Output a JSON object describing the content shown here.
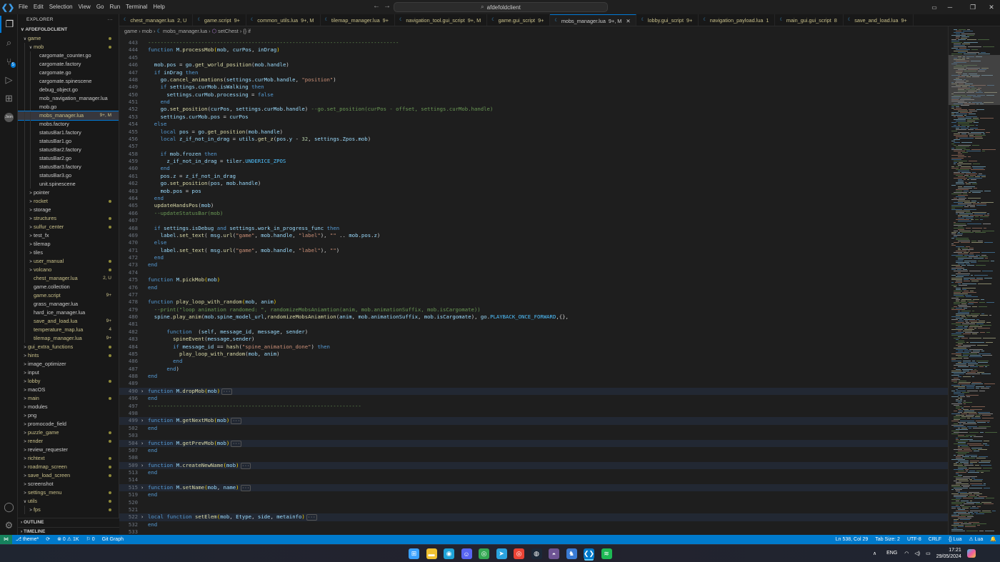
{
  "menu": [
    "File",
    "Edit",
    "Selection",
    "View",
    "Go",
    "Run",
    "Terminal",
    "Help"
  ],
  "command_center": "afdefoldclient",
  "window_controls": [
    "─",
    "❐",
    "✕"
  ],
  "explorer": {
    "title": "EXPLORER",
    "project": "AFDEFOLDCLIENT",
    "rows": [
      {
        "label": "game",
        "chev": "∨",
        "indent": 0,
        "color": "#c9c08a",
        "dot": true
      },
      {
        "label": "mob",
        "chev": "∨",
        "indent": 1,
        "color": "#c9c08a",
        "dot": true
      },
      {
        "label": "cargomate_counter.go",
        "chev": "",
        "indent": 2,
        "color": "#cccccc"
      },
      {
        "label": "cargomate.factory",
        "chev": "",
        "indent": 2,
        "color": "#cccccc"
      },
      {
        "label": "cargomate.go",
        "chev": "",
        "indent": 2,
        "color": "#cccccc"
      },
      {
        "label": "cargomate.spinescene",
        "chev": "",
        "indent": 2,
        "color": "#cccccc"
      },
      {
        "label": "debug_object.go",
        "chev": "",
        "indent": 2,
        "color": "#cccccc"
      },
      {
        "label": "mob_navigation_manager.lua",
        "chev": "",
        "indent": 2,
        "color": "#cccccc"
      },
      {
        "label": "mob.go",
        "chev": "",
        "indent": 2,
        "color": "#cccccc"
      },
      {
        "label": "mobs_manager.lua",
        "chev": "",
        "indent": 2,
        "color": "#c9c08a",
        "status": "9+, M",
        "selected": true
      },
      {
        "label": "mobs.factory",
        "chev": "",
        "indent": 2,
        "color": "#cccccc"
      },
      {
        "label": "statusBar1.factory",
        "chev": "",
        "indent": 2,
        "color": "#cccccc"
      },
      {
        "label": "statusBar1.go",
        "chev": "",
        "indent": 2,
        "color": "#cccccc"
      },
      {
        "label": "statusBar2.factory",
        "chev": "",
        "indent": 2,
        "color": "#cccccc"
      },
      {
        "label": "statusBar2.go",
        "chev": "",
        "indent": 2,
        "color": "#cccccc"
      },
      {
        "label": "statusBar3.factory",
        "chev": "",
        "indent": 2,
        "color": "#cccccc"
      },
      {
        "label": "statusBar3.go",
        "chev": "",
        "indent": 2,
        "color": "#cccccc"
      },
      {
        "label": "unit.spinescene",
        "chev": "",
        "indent": 2,
        "color": "#cccccc"
      },
      {
        "label": "pointer",
        "chev": ">",
        "indent": 1,
        "color": "#cccccc"
      },
      {
        "label": "rocket",
        "chev": ">",
        "indent": 1,
        "color": "#c9c08a",
        "dot": true
      },
      {
        "label": "storage",
        "chev": ">",
        "indent": 1,
        "color": "#cccccc"
      },
      {
        "label": "structures",
        "chev": ">",
        "indent": 1,
        "color": "#c9c08a",
        "dot": true
      },
      {
        "label": "sulfur_center",
        "chev": ">",
        "indent": 1,
        "color": "#c9c08a",
        "dot": true
      },
      {
        "label": "test_fx",
        "chev": ">",
        "indent": 1,
        "color": "#cccccc"
      },
      {
        "label": "tilemap",
        "chev": ">",
        "indent": 1,
        "color": "#cccccc"
      },
      {
        "label": "tiles",
        "chev": ">",
        "indent": 1,
        "color": "#cccccc"
      },
      {
        "label": "user_manual",
        "chev": ">",
        "indent": 1,
        "color": "#c9c08a",
        "dot": true
      },
      {
        "label": "volcano",
        "chev": ">",
        "indent": 1,
        "color": "#c9c08a",
        "dot": true
      },
      {
        "label": "chest_manager.lua",
        "chev": "",
        "indent": 1,
        "color": "#c9c08a",
        "status": "2, U"
      },
      {
        "label": "game.collection",
        "chev": "",
        "indent": 1,
        "color": "#cccccc"
      },
      {
        "label": "game.script",
        "chev": "",
        "indent": 1,
        "color": "#c9c08a",
        "status": "9+"
      },
      {
        "label": "grass_manager.lua",
        "chev": "",
        "indent": 1,
        "color": "#cccccc"
      },
      {
        "label": "hard_ice_manager.lua",
        "chev": "",
        "indent": 1,
        "color": "#cccccc"
      },
      {
        "label": "save_and_load.lua",
        "chev": "",
        "indent": 1,
        "color": "#c9c08a",
        "status": "9+"
      },
      {
        "label": "temperature_map.lua",
        "chev": "",
        "indent": 1,
        "color": "#c9c08a",
        "status": "4"
      },
      {
        "label": "tilemap_manager.lua",
        "chev": "",
        "indent": 1,
        "color": "#c9c08a",
        "status": "9+"
      },
      {
        "label": "gui_extra_functions",
        "chev": ">",
        "indent": 0,
        "color": "#c9c08a",
        "dot": true
      },
      {
        "label": "hints",
        "chev": ">",
        "indent": 0,
        "color": "#c9c08a",
        "dot": true
      },
      {
        "label": "image_optimizer",
        "chev": ">",
        "indent": 0,
        "color": "#cccccc"
      },
      {
        "label": "input",
        "chev": ">",
        "indent": 0,
        "color": "#cccccc"
      },
      {
        "label": "lobby",
        "chev": ">",
        "indent": 0,
        "color": "#c9c08a",
        "dot": true
      },
      {
        "label": "macOS",
        "chev": ">",
        "indent": 0,
        "color": "#cccccc"
      },
      {
        "label": "main",
        "chev": ">",
        "indent": 0,
        "color": "#c9c08a",
        "dot": true
      },
      {
        "label": "modules",
        "chev": ">",
        "indent": 0,
        "color": "#cccccc"
      },
      {
        "label": "png",
        "chev": ">",
        "indent": 0,
        "color": "#cccccc"
      },
      {
        "label": "promocode_field",
        "chev": ">",
        "indent": 0,
        "color": "#cccccc"
      },
      {
        "label": "puzzle_game",
        "chev": ">",
        "indent": 0,
        "color": "#c9c08a",
        "dot": true
      },
      {
        "label": "render",
        "chev": ">",
        "indent": 0,
        "color": "#c9c08a",
        "dot": true
      },
      {
        "label": "review_requester",
        "chev": ">",
        "indent": 0,
        "color": "#cccccc"
      },
      {
        "label": "richtext",
        "chev": ">",
        "indent": 0,
        "color": "#c9c08a",
        "dot": true
      },
      {
        "label": "roadmap_screen",
        "chev": ">",
        "indent": 0,
        "color": "#c9c08a",
        "dot": true
      },
      {
        "label": "save_load_screen",
        "chev": ">",
        "indent": 0,
        "color": "#c9c08a",
        "dot": true
      },
      {
        "label": "screenshot",
        "chev": ">",
        "indent": 0,
        "color": "#cccccc"
      },
      {
        "label": "settings_menu",
        "chev": ">",
        "indent": 0,
        "color": "#c9c08a",
        "dot": true
      },
      {
        "label": "utils",
        "chev": "∨",
        "indent": 0,
        "color": "#c9c08a",
        "dot": true
      },
      {
        "label": "fps",
        "chev": ">",
        "indent": 1,
        "color": "#c9c08a",
        "dot": true
      }
    ],
    "outline": "OUTLINE",
    "timeline": "TIMELINE"
  },
  "tabs": [
    {
      "label": "chest_manager.lua",
      "status": "2, U"
    },
    {
      "label": "game.script",
      "status": "9+"
    },
    {
      "label": "common_utils.lua",
      "status": "9+, M"
    },
    {
      "label": "tilemap_manager.lua",
      "status": "9+"
    },
    {
      "label": "navigation_tool.gui_script",
      "status": "9+, M"
    },
    {
      "label": "game.gui_script",
      "status": "9+"
    },
    {
      "label": "mobs_manager.lua",
      "status": "9+, M",
      "active": true
    },
    {
      "label": "lobby.gui_script",
      "status": "9+"
    },
    {
      "label": "navigation_payload.lua",
      "status": "1"
    },
    {
      "label": "main_gui.gui_script",
      "status": "8"
    },
    {
      "label": "save_and_load.lua",
      "status": "9+"
    }
  ],
  "breadcrumb": [
    "game",
    "mob",
    "mobs_manager.lua",
    "setChest",
    "{} if"
  ],
  "code_lines": [
    {
      "n": "443",
      "t": "--------------------------------------------------------------------------------",
      "cls": "c"
    },
    {
      "n": "444",
      "h": "<span class='k'>function</span> <span class='v'>M</span>.<span class='f'>processMob</span><span class='p'>(</span><span class='v'>mob</span>, <span class='v'>curPos</span>, <span class='v'>inDrag</span><span class='p'>)</span>"
    },
    {
      "n": "445",
      "h": ""
    },
    {
      "n": "446",
      "h": "  <span class='v'>mob</span>.<span class='v'>pos</span> = <span class='v'>go</span>.<span class='f'>get_world_position</span>(<span class='v'>mob</span>.<span class='v'>handle</span>)"
    },
    {
      "n": "447",
      "h": "  <span class='k'>if</span> <span class='v'>inDrag</span> <span class='k'>then</span>"
    },
    {
      "n": "448",
      "h": "    <span class='v'>go</span>.<span class='f'>cancel_animations</span>(<span class='v'>settings</span>.<span class='v'>curMob</span>.<span class='v'>handle</span>, <span class='s'>\"position\"</span>)"
    },
    {
      "n": "449",
      "h": "    <span class='k'>if</span> <span class='v'>settings</span>.<span class='v'>curMob</span>.<span class='v'>isWalking</span> <span class='k'>then</span>"
    },
    {
      "n": "450",
      "h": "      <span class='v'>settings</span>.<span class='v'>curMob</span>.<span class='v'>processing</span> = <span class='k'>false</span>"
    },
    {
      "n": "451",
      "h": "    <span class='k'>end</span>"
    },
    {
      "n": "452",
      "h": "    <span class='v'>go</span>.<span class='f'>set_position</span>(<span class='v'>curPos</span>, <span class='v'>settings</span>.<span class='v'>curMob</span>.<span class='v'>handle</span>) <span class='c'>--go.set_position(curPos - offset, settings.curMob.handle)</span>"
    },
    {
      "n": "453",
      "h": "    <span class='v'>settings</span>.<span class='v'>curMob</span>.<span class='v'>pos</span> = <span class='v'>curPos</span>"
    },
    {
      "n": "454",
      "h": "  <span class='k'>else</span>"
    },
    {
      "n": "455",
      "h": "    <span class='k'>local</span> <span class='v'>pos</span> = <span class='v'>go</span>.<span class='f'>get_position</span>(<span class='v'>mob</span>.<span class='v'>handle</span>)"
    },
    {
      "n": "456",
      "h": "    <span class='k'>local</span> <span class='v'>z_if_not_in_drag</span> = <span class='v'>utils</span>.<span class='f'>get_z</span>(<span class='v'>pos</span>.<span class='v'>y</span> - <span class='n'>32</span>, <span class='v'>settings</span>.<span class='v'>Zpos</span>.<span class='v'>mob</span>)"
    },
    {
      "n": "457",
      "h": ""
    },
    {
      "n": "458",
      "h": "    <span class='k'>if</span> <span class='v'>mob</span>.<span class='v'>frozen</span> <span class='k'>then</span>"
    },
    {
      "n": "459",
      "h": "      <span class='v'>z_if_not_in_drag</span> = <span class='v'>tiler</span>.<span class='cs'>UNDERICE_ZPOS</span>"
    },
    {
      "n": "460",
      "h": "    <span class='k'>end</span>"
    },
    {
      "n": "461",
      "h": "    <span class='v'>pos</span>.<span class='v'>z</span> = <span class='v'>z_if_not_in_drag</span>"
    },
    {
      "n": "462",
      "h": "    <span class='v'>go</span>.<span class='f'>set_position</span>(<span class='v'>pos</span>, <span class='v'>mob</span>.<span class='v'>handle</span>)"
    },
    {
      "n": "463",
      "h": "    <span class='v'>mob</span>.<span class='v'>pos</span> = <span class='v'>pos</span>"
    },
    {
      "n": "464",
      "h": "  <span class='k'>end</span>"
    },
    {
      "n": "465",
      "h": "  <span class='f'>updateHandsPos</span>(<span class='v'>mob</span>)"
    },
    {
      "n": "466",
      "h": "  <span class='c'>--updateStatusBar(mob)</span>"
    },
    {
      "n": "467",
      "h": ""
    },
    {
      "n": "468",
      "h": "  <span class='k'>if</span> <span class='v'>settings</span>.<span class='v'>isDebug</span> <span class='k'>and</span> <span class='v'>settings</span>.<span class='v'>work_in_progress_func</span> <span class='k'>then</span>"
    },
    {
      "n": "469",
      "h": "    <span class='v'>label</span>.<span class='f'>set_text</span>( <span class='v'>msg</span>.<span class='f'>url</span>(<span class='s'>\"game\"</span>, <span class='v'>mob</span>.<span class='v'>handle</span>, <span class='s'>\"label\"</span>), <span class='s'>\"\"</span> .. <span class='v'>mob</span>.<span class='v'>pos</span>.<span class='v'>z</span>)"
    },
    {
      "n": "470",
      "h": "  <span class='k'>else</span>"
    },
    {
      "n": "471",
      "h": "    <span class='v'>label</span>.<span class='f'>set_text</span>( <span class='v'>msg</span>.<span class='f'>url</span>(<span class='s'>\"game\"</span>, <span class='v'>mob</span>.<span class='v'>handle</span>, <span class='s'>\"label\"</span>), <span class='s'>\"\"</span>)"
    },
    {
      "n": "472",
      "h": "  <span class='k'>end</span>"
    },
    {
      "n": "473",
      "h": "<span class='k'>end</span>"
    },
    {
      "n": "474",
      "h": ""
    },
    {
      "n": "475",
      "h": "<span class='k'>function</span> <span class='v'>M</span>.<span class='f'>pickMob</span><span class='p'>(</span><span class='v'>mob</span><span class='p'>)</span>"
    },
    {
      "n": "476",
      "h": "<span class='k'>end</span>"
    },
    {
      "n": "477",
      "h": ""
    },
    {
      "n": "478",
      "h": "<span class='k'>function</span> <span class='f'>play_loop_with_random</span><span class='p'>(</span><span class='v'>mob</span>, <span class='v'>anim</span><span class='p'>)</span>"
    },
    {
      "n": "479",
      "h": "  <span class='c'>--print(\"loop animation randomed: \", randomizeMobsAniamtion(anim, mob.animationSuffix, mob.isCargomate))</span>"
    },
    {
      "n": "480",
      "h": "  <span class='v'>spine</span>.<span class='f'>play_anim</span>(<span class='v'>mob</span>.<span class='v'>spine_model_url</span>,<span class='f'>randomizeMobsAniamtion</span>(<span class='v'>anim</span>, <span class='v'>mob</span>.<span class='v'>animationSuffix</span>, <span class='v'>mob</span>.<span class='v'>isCargomate</span>), <span class='v'>go</span>.<span class='cs'>PLAYBACK_ONCE_FORWARD</span>,{},"
    },
    {
      "n": "481",
      "h": ""
    },
    {
      "n": "482",
      "h": "      <span class='k'>function</span>  (<span class='v'>self</span>, <span class='v'>message_id</span>, <span class='v'>message</span>, <span class='v'>sender</span>)"
    },
    {
      "n": "483",
      "h": "        <span class='f'>spineEvent</span>(<span class='v'>message</span>,<span class='v'>sender</span>)"
    },
    {
      "n": "484",
      "h": "        <span class='k'>if</span> <span class='v'>message_id</span> == <span class='f'>hash</span>(<span class='s'>\"spine_animation_done\"</span>) <span class='k'>then</span>"
    },
    {
      "n": "485",
      "h": "          <span class='f'>play_loop_with_random</span>(<span class='v'>mob</span>, <span class='v'>anim</span>)"
    },
    {
      "n": "486",
      "h": "        <span class='k'>end</span>"
    },
    {
      "n": "487",
      "h": "      <span class='k'>end</span>)"
    },
    {
      "n": "488",
      "h": "<span class='k'>end</span>"
    },
    {
      "n": "489",
      "h": ""
    },
    {
      "n": "490",
      "fold": true,
      "h": "<span class='k'>function</span> <span class='v'>M</span>.<span class='f'>dropMob</span><span class='p'>(</span><span class='v'>mob</span><span class='p'>)</span><span class='fo'>···</span>"
    },
    {
      "n": "496",
      "h": "<span class='k'>end</span>"
    },
    {
      "n": "497",
      "t": "--------------------------------------------------------------------",
      "cls": "c"
    },
    {
      "n": "498",
      "h": ""
    },
    {
      "n": "499",
      "fold": true,
      "h": "<span class='k'>function</span> <span class='v'>M</span>.<span class='f'>getNextMob</span><span class='p'>(</span><span class='v'>mob</span><span class='p'>)</span><span class='fo'>···</span>"
    },
    {
      "n": "502",
      "h": "<span class='k'>end</span>"
    },
    {
      "n": "503",
      "h": ""
    },
    {
      "n": "504",
      "fold": true,
      "h": "<span class='k'>function</span> <span class='v'>M</span>.<span class='f'>getPrevMob</span><span class='p'>(</span><span class='v'>mob</span><span class='p'>)</span><span class='fo'>···</span>"
    },
    {
      "n": "507",
      "h": "<span class='k'>end</span>"
    },
    {
      "n": "508",
      "h": ""
    },
    {
      "n": "509",
      "fold": true,
      "h": "<span class='k'>function</span> <span class='v'>M</span>.<span class='f'>createNewName</span><span class='p'>(</span><span class='v'>mob</span><span class='p'>)</span><span class='fo'>···</span>"
    },
    {
      "n": "513",
      "h": "<span class='k'>end</span>"
    },
    {
      "n": "514",
      "h": ""
    },
    {
      "n": "515",
      "fold": true,
      "h": "<span class='k'>function</span> <span class='v'>M</span>.<span class='f'>setName</span><span class='p'>(</span><span class='v'>mob</span>, <span class='v'>name</span><span class='p'>)</span><span class='fo'>···</span>"
    },
    {
      "n": "519",
      "h": "<span class='k'>end</span>"
    },
    {
      "n": "520",
      "h": ""
    },
    {
      "n": "521",
      "h": ""
    },
    {
      "n": "522",
      "fold": true,
      "h": "<span class='k'>local</span> <span class='k'>function</span> <span class='f'>setElem</span><span class='p'>(</span><span class='v'>mob</span>, <span class='v'>Etype</span>, <span class='v'>side</span>, <span class='v'>metainfo</span><span class='p'>)</span><span class='fo'>···</span>"
    },
    {
      "n": "532",
      "h": "<span class='k'>end</span>"
    },
    {
      "n": "533",
      "h": ""
    }
  ],
  "statusbar": {
    "left": [
      "⎇ theme*",
      "⟳",
      "⊗ 0 ⚠ 1K",
      "⚐ 0",
      "Git Graph"
    ],
    "right": [
      "Ln 538, Col 29",
      "Tab Size: 2",
      "UTF-8",
      "CRLF",
      "{} Lua",
      "⚠ Lua",
      "🔔"
    ]
  },
  "taskbar": {
    "lang": "ENG",
    "time": "17:21",
    "date": "29/05/2024",
    "apps": [
      {
        "name": "windows-start-icon",
        "glyph": "⊞",
        "color": "#3aa0ff"
      },
      {
        "name": "file-explorer-icon",
        "glyph": "▬",
        "color": "#f0c030"
      },
      {
        "name": "edge-icon",
        "glyph": "◉",
        "color": "#1fa3d8"
      },
      {
        "name": "discord-icon",
        "glyph": "☺",
        "color": "#5865f2"
      },
      {
        "name": "chrome-icon",
        "glyph": "◎",
        "color": "#34a853"
      },
      {
        "name": "telegram-icon",
        "glyph": "➤",
        "color": "#2aa3df"
      },
      {
        "name": "chrome-app-icon",
        "glyph": "◎",
        "color": "#ea4335"
      },
      {
        "name": "steam-icon",
        "glyph": "◍",
        "color": "#1b2838"
      },
      {
        "name": "github-desktop-icon",
        "glyph": "◓",
        "color": "#6e5494"
      },
      {
        "name": "defold-icon",
        "glyph": "♞",
        "color": "#3a7bd5"
      },
      {
        "name": "vscode-icon",
        "glyph": "❮❯",
        "color": "#007acc"
      },
      {
        "name": "spotify-icon",
        "glyph": "≋",
        "color": "#1db954"
      }
    ]
  }
}
